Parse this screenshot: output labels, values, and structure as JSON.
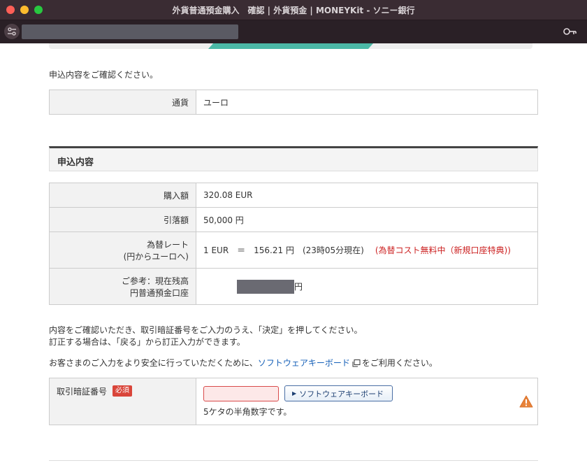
{
  "window": {
    "title": "外貨普通預金購入　確認 | 外貨預金 | MONEYKit - ソニー銀行"
  },
  "progress": {
    "current_step": 3,
    "total_steps": 5
  },
  "intro": {
    "text": "申込内容をご確認ください。"
  },
  "currency_table": {
    "label": "通貨",
    "value": "ユーロ"
  },
  "section": {
    "title": "申込内容"
  },
  "details": {
    "purchase_label": "購入額",
    "purchase_value": "320.08 EUR",
    "debit_label": "引落額",
    "debit_value": "50,000 円",
    "rate_label_1": "為替レート",
    "rate_label_2": "(円からユーロへ)",
    "rate_value": "1 EUR　＝　156.21 円　(23時05分現在)",
    "rate_note": "(為替コスト無料中（新規口座特典))",
    "balance_label_1": "ご参考：現在残高",
    "balance_label_2": "円普通預金口座",
    "balance_unit": "円"
  },
  "instructions": {
    "line1": "内容をご確認いただき、取引暗証番号をご入力のうえ、「決定」を押してください。",
    "line2": "訂正する場合は、「戻る」から訂正入力ができます。",
    "security_prefix": "お客さまのご入力をより安全に行っていただくために、",
    "security_link": "ソフトウェアキーボード",
    "security_suffix": "をご利用ください。"
  },
  "pin": {
    "label": "取引暗証番号",
    "required": "必須",
    "placeholder": "",
    "keyboard_button": "ソフトウェアキーボード",
    "hint": "5ケタの半角数字です。"
  },
  "colors": {
    "accent": "#4bb8a6",
    "link": "#1660b8",
    "alert": "#cc2222",
    "required": "#d9453a"
  }
}
